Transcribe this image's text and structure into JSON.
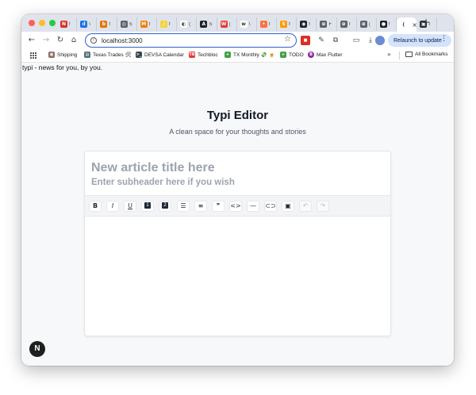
{
  "browser": {
    "tabs": [
      {
        "favicon_color": "#d93025",
        "favicon_text": "N",
        "label": "f"
      },
      {
        "favicon_color": "#1a73e8",
        "favicon_text": "ıl",
        "label": "\\"
      },
      {
        "favicon_color": "#e37400",
        "favicon_text": "b",
        "label": "f"
      },
      {
        "favicon_color": "#5f6368",
        "favicon_text": "◎",
        "label": "S"
      },
      {
        "favicon_color": "#f57c00",
        "favicon_text": "M",
        "label": "f"
      },
      {
        "favicon_color": "#f5d33b",
        "favicon_text": "/",
        "label": "f"
      },
      {
        "favicon_color": "#ffffff",
        "favicon_text": "◐",
        "label": "("
      },
      {
        "favicon_color": "#202124",
        "favicon_text": "A",
        "label": "S"
      },
      {
        "favicon_color": "#e53935",
        "favicon_text": "W",
        "label": "("
      },
      {
        "favicon_color": "#ffffff",
        "favicon_text": "w",
        "label": "\\"
      },
      {
        "favicon_color": "#ff7043",
        "favicon_text": "•",
        "label": "f"
      },
      {
        "favicon_color": "#ff9800",
        "favicon_text": "S",
        "label": "f"
      },
      {
        "favicon_color": "#202124",
        "favicon_text": "◉",
        "label": "f"
      },
      {
        "favicon_color": "#5f6368",
        "favicon_text": "⊕",
        "label": "F"
      },
      {
        "favicon_color": "#5f6368",
        "favicon_text": "⊕",
        "label": "f"
      },
      {
        "favicon_color": "#5f6368",
        "favicon_text": "⊕",
        "label": "("
      },
      {
        "favicon_color": "#202124",
        "favicon_text": "●",
        "label": "f"
      },
      {
        "favicon_color": "#ffffff",
        "favicon_text": "(",
        "label": "",
        "active": true,
        "close": "×"
      },
      {
        "favicon_color": "#263238",
        "favicon_text": "▣",
        "label": "f"
      }
    ],
    "new_tab": "+",
    "url": "localhost:3000",
    "relaunch_label": "Relaunch to update",
    "bookmarks": [
      {
        "label": "Shipping",
        "color": "#8d6e63",
        "icon": "▣"
      },
      {
        "label": "Texas Trades 🛠",
        "color": "#546e7a",
        "icon": "▤"
      },
      {
        "label": "DEVSA Calendar",
        "color": "#37474f",
        "icon": ">_"
      },
      {
        "label": "Techbloc",
        "color": "#e53935",
        "icon": "TB"
      },
      {
        "label": "TX Monthly 💸 🍺",
        "color": "#43a047",
        "icon": "+"
      },
      {
        "label": "TODO",
        "color": "#43a047",
        "icon": "+"
      },
      {
        "label": "Max Flutter",
        "color": "#8e24aa",
        "icon": "B"
      }
    ],
    "bookmarks_more": "»",
    "all_bookmarks": "All Bookmarks"
  },
  "page": {
    "tagline": "typi - news for you, by you.",
    "heading": "Typi Editor",
    "subheading": "A clean space for your thoughts and stories",
    "title_placeholder": "New article title here",
    "subheader_placeholder": "Enter subheader here if you wish",
    "toolbar": [
      {
        "name": "bold-button",
        "glyph": "B"
      },
      {
        "name": "italic-button",
        "glyph": "I"
      },
      {
        "name": "underline-button",
        "glyph": "U"
      },
      {
        "name": "heading1-button",
        "glyph": "1"
      },
      {
        "name": "heading2-button",
        "glyph": "2"
      },
      {
        "name": "bullet-list-button",
        "glyph": "☰"
      },
      {
        "name": "ordered-list-button",
        "glyph": "≡"
      },
      {
        "name": "blockquote-button",
        "glyph": "❞"
      },
      {
        "name": "code-button",
        "glyph": "<>"
      },
      {
        "name": "horizontal-rule-button",
        "glyph": "—"
      },
      {
        "name": "link-button",
        "glyph": "⊂⊃"
      },
      {
        "name": "image-button",
        "glyph": "▣"
      },
      {
        "name": "undo-button",
        "glyph": "↶",
        "disabled": true
      },
      {
        "name": "redo-button",
        "glyph": "↷",
        "disabled": true
      }
    ],
    "next_badge": "N"
  },
  "colors": {
    "accent": "#2f5ecb",
    "page_bg": "#f7f8fa",
    "placeholder": "#9ca3af"
  }
}
